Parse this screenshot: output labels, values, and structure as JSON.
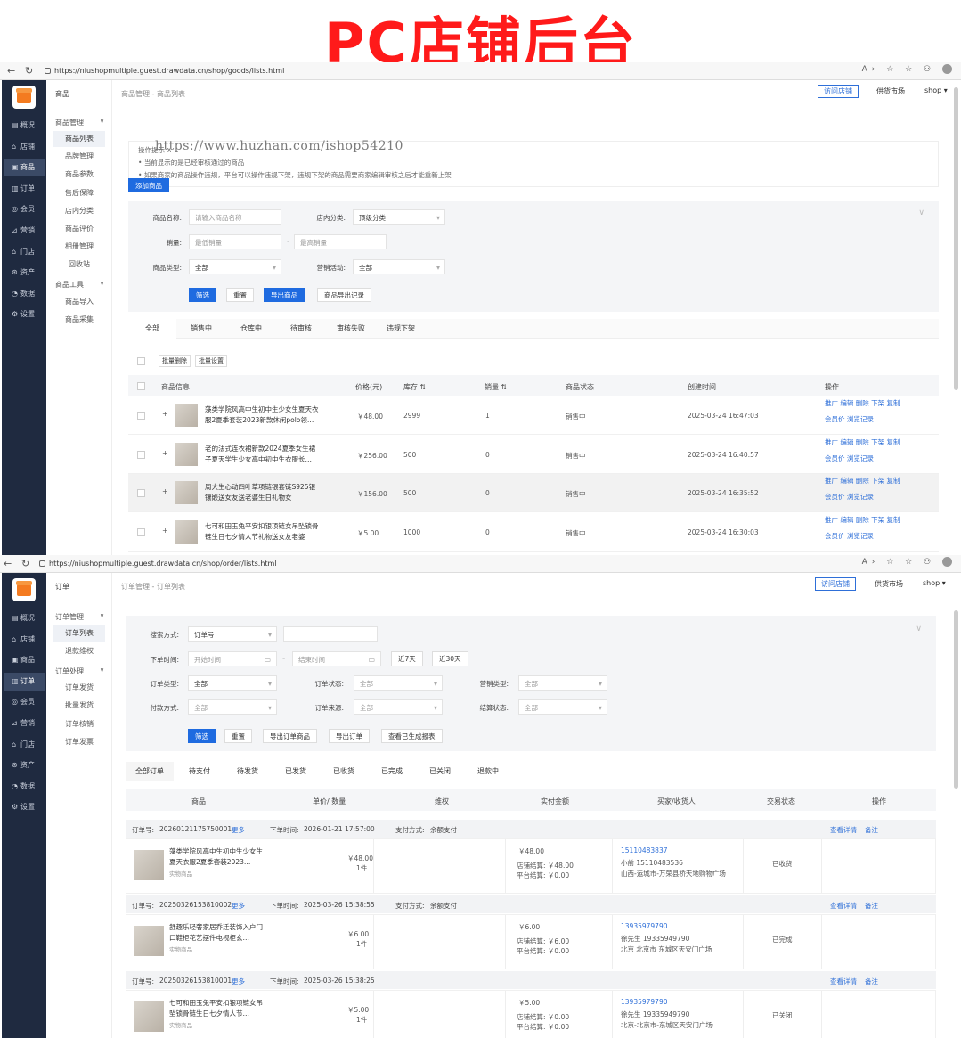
{
  "banner": {
    "title": "PC店铺后台"
  },
  "browser1": {
    "url": "https://niushopmultiple.guest.drawdata.cn/shop/goods/lists.html"
  },
  "browser2": {
    "url": "https://niushopmultiple.guest.drawdata.cn/shop/order/lists.html"
  },
  "browser_icons": "A› ☆ ☆ ⚇",
  "sidebar": {
    "items": [
      {
        "label": "概况",
        "icon": "▤"
      },
      {
        "label": "店铺",
        "icon": "⌂"
      },
      {
        "label": "商品",
        "icon": "▣"
      },
      {
        "label": "订单",
        "icon": "▥"
      },
      {
        "label": "会员",
        "icon": "◎"
      },
      {
        "label": "营销",
        "icon": "⊿"
      },
      {
        "label": "门店",
        "icon": "⌂"
      },
      {
        "label": "资产",
        "icon": "⊛"
      },
      {
        "label": "数据",
        "icon": "◔"
      },
      {
        "label": "设置",
        "icon": "⚙"
      }
    ]
  },
  "top": {
    "visit": "访问店铺",
    "market": "供货市场",
    "user": "shop ▾"
  },
  "watermark": "https://www.huzhan.com/ishop54210",
  "goods": {
    "submenu_head": "商品",
    "group1": "商品管理",
    "group1_items": [
      "商品列表",
      "品牌管理",
      "商品参数",
      "售后保障",
      "店内分类",
      "商品评价",
      "相册管理",
      "回收站"
    ],
    "group2": "商品工具",
    "group2_items": [
      "商品导入",
      "商品采集"
    ],
    "crumb": "商品管理 - 商品列表",
    "tips_title": "操作提示 ∧",
    "tips": [
      "当前显示的是已经审核通过的商品",
      "如果商家的商品操作违规，平台可以操作违规下架，违规下架的商品需要商家编辑审核之后才能重新上架"
    ],
    "add_btn": "添加商品",
    "filter": {
      "name_label": "商品名称:",
      "name_ph": "请输入商品名称",
      "cat_label": "店内分类:",
      "cat_val": "顶级分类",
      "sales_label": "销量:",
      "sales_min": "最低销量",
      "sales_max": "最高销量",
      "dash": "-",
      "type_label": "商品类型:",
      "type_val": "全部",
      "promo_label": "营销活动:",
      "promo_val": "全部",
      "btn_filter": "筛选",
      "btn_reset": "重置",
      "btn_export": "导出商品",
      "btn_record": "商品导出记录"
    },
    "tabs": [
      "全部",
      "销售中",
      "仓库中",
      "待审核",
      "审核失败",
      "违规下架"
    ],
    "batch": [
      "批量删除",
      "批量设置"
    ],
    "cols": [
      "商品信息",
      "价格(元)",
      "库存 ⇅",
      "销量 ⇅",
      "商品状态",
      "创建时间",
      "操作"
    ],
    "rows": [
      {
        "name": "藻类学院风高中生初中生少女生夏天衣服2夏季套装2023新款休闲polo领…",
        "price": "￥48.00",
        "stock": "2999",
        "sales": "1",
        "status": "销售中",
        "time": "2025-03-24 16:47:03"
      },
      {
        "name": "老的法式连衣裙新款2024夏季女生裙子夏天学生少女高中初中生衣服长…",
        "price": "￥256.00",
        "stock": "500",
        "sales": "0",
        "status": "销售中",
        "time": "2025-03-24 16:40:57"
      },
      {
        "name": "周大生心动四叶草项链银套链S925银镶嵌送女友送老婆生日礼物女",
        "price": "￥156.00",
        "stock": "500",
        "sales": "0",
        "status": "销售中",
        "time": "2025-03-24 16:35:52"
      },
      {
        "name": "七可和田玉兔平安扣银项链女吊坠锁骨链生日七夕情人节礼物送女友老婆",
        "price": "￥5.00",
        "stock": "1000",
        "sales": "0",
        "status": "销售中",
        "time": "2025-03-24 16:30:03"
      }
    ],
    "ops1": "推广 编辑 删除 下架 复制",
    "ops2": "会员价 浏览记录"
  },
  "orders": {
    "submenu_head": "订单",
    "group1": "订单管理",
    "group1_items": [
      "订单列表",
      "退款维权"
    ],
    "group2": "订单处理",
    "group2_items": [
      "订单发货",
      "批量发货",
      "订单核销",
      "订单发票"
    ],
    "crumb": "订单管理 - 订单列表",
    "filter": {
      "search_label": "搜索方式:",
      "search_val": "订单号",
      "time_label": "下单时间:",
      "start": "开始时间",
      "end": "结束时间",
      "d7": "近7天",
      "d30": "近30天",
      "otype_label": "订单类型:",
      "otype_val": "全部",
      "ostatus_label": "订单状态:",
      "ostatus_val": "全部",
      "mtype_label": "营销类型:",
      "mtype_val": "全部",
      "pay_label": "付款方式:",
      "pay_val": "全部",
      "src_label": "订单来源:",
      "src_val": "全部",
      "settle_label": "结算状态:",
      "settle_val": "全部",
      "btn_filter": "筛选",
      "btn_reset": "重置",
      "btn_exp_goods": "导出订单商品",
      "btn_exp_order": "导出订单",
      "btn_report": "查看已生成报表"
    },
    "tabs": [
      "全部订单",
      "待支付",
      "待发货",
      "已发货",
      "已收货",
      "已完成",
      "已关闭",
      "退款中"
    ],
    "cols": [
      "商品",
      "单价/ 数量",
      "维权",
      "实付金额",
      "买家/收货人",
      "交易状态",
      "操作"
    ],
    "list": [
      {
        "no_label": "订单号:",
        "no": "20260121175750001",
        "more": "更多",
        "time_label": "下单时间:",
        "time": "2026-01-21 17:57:00",
        "pay_label": "支付方式:",
        "pay": "余额支付",
        "detail": "查看详情",
        "note": "备注",
        "name": "藻类学院风高中生初中生少女生夏天衣服2夏季套装2023…",
        "kind": "实物商品",
        "price": "￥48.00",
        "qty": "1件",
        "amt": "￥48.00",
        "shop_settle": "店铺结算: ￥48.00",
        "plat_settle": "平台结算: ￥0.00",
        "phone": "15110483837",
        "buyer": "小前 15110483536",
        "addr": "山西-运城市-万荣县桥天地购物广场",
        "status": "已收货"
      },
      {
        "no_label": "订单号:",
        "no": "20250326153810002",
        "more": "更多",
        "time_label": "下单时间:",
        "time": "2025-03-26 15:38:55",
        "pay_label": "支付方式:",
        "pay": "余额支付",
        "detail": "查看详情",
        "note": "备注",
        "name": "舒趣乐轻奢家居乔迁装饰入户门口鞋柜花艺摆件电视柜玄…",
        "kind": "实物商品",
        "price": "￥6.00",
        "qty": "1件",
        "amt": "￥6.00",
        "shop_settle": "店铺结算: ￥6.00",
        "plat_settle": "平台结算: ￥0.00",
        "phone": "13935979790",
        "buyer": "徐先生 19335949790",
        "addr": "北京 北京市 东城区天安门广场",
        "status": "已完成"
      },
      {
        "no_label": "订单号:",
        "no": "20250326153810001",
        "more": "更多",
        "time_label": "下单时间:",
        "time": "2025-03-26 15:38:25",
        "pay_label": "",
        "pay": "",
        "detail": "查看详情",
        "note": "备注",
        "name": "七可和田玉兔平安扣银项链女吊坠锁骨链生日七夕情人节…",
        "kind": "实物商品",
        "price": "￥5.00",
        "qty": "1件",
        "amt": "￥5.00",
        "shop_settle": "店铺结算: ￥0.00",
        "plat_settle": "平台结算: ￥0.00",
        "phone": "13935979790",
        "buyer": "徐先生 19335949790",
        "addr": "北京-北京市-东城区天安门广场",
        "status": "已关闭"
      }
    ]
  }
}
